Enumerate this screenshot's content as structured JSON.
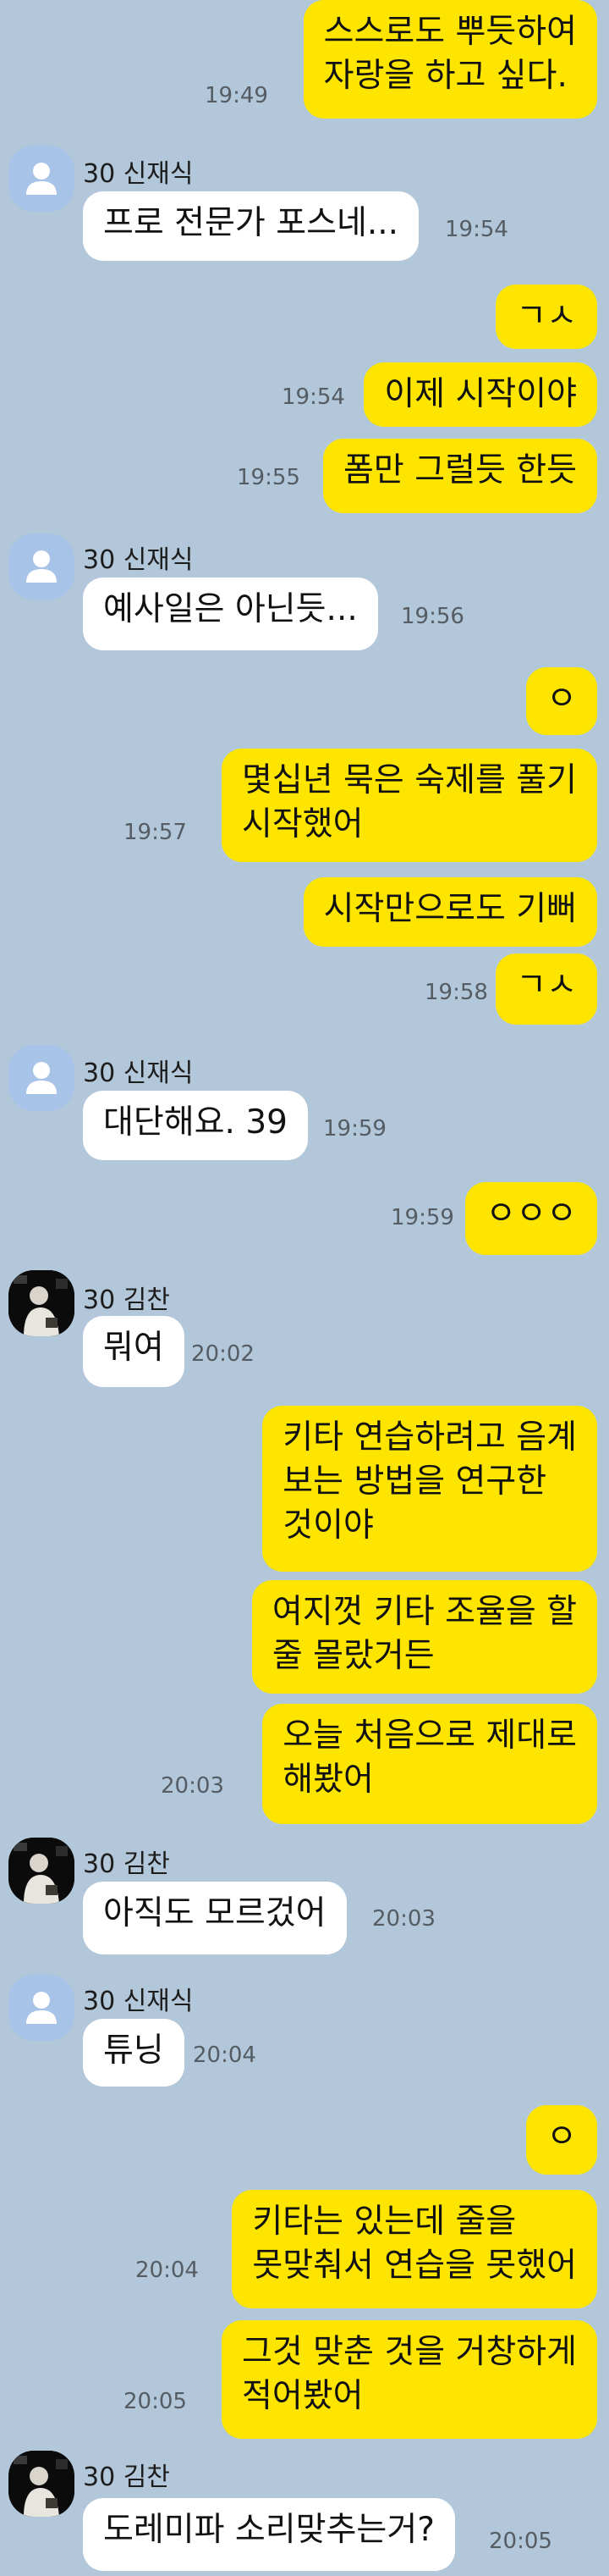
{
  "chat": {
    "messages": [
      {
        "side": "me",
        "text": "스스로도 뿌듯하여\n자랑을 하고 싶다.",
        "time": "19:49"
      },
      {
        "side": "them",
        "sender": "30 신재식",
        "avatar": "default",
        "text": "프로 전문가 포스네...",
        "time": "19:54"
      },
      {
        "side": "me",
        "text": "ㄱㅅ",
        "time": ""
      },
      {
        "side": "me",
        "text": "이제 시작이야",
        "time": "19:54"
      },
      {
        "side": "me",
        "text": "폼만 그럴듯 한듯",
        "time": "19:55"
      },
      {
        "side": "them",
        "sender": "30 신재식",
        "avatar": "default",
        "text": "예사일은 아닌듯...",
        "time": "19:56"
      },
      {
        "side": "me",
        "text": "ㅇ",
        "time": ""
      },
      {
        "side": "me",
        "text": "몇십년 묵은 숙제를 풀기\n시작했어",
        "time": "19:57"
      },
      {
        "side": "me",
        "text": "시작만으로도 기뻐",
        "time": ""
      },
      {
        "side": "me",
        "text": "ㄱㅅ",
        "time": "19:58"
      },
      {
        "side": "them",
        "sender": "30 신재식",
        "avatar": "default",
        "text": "대단해요. 39",
        "time": "19:59"
      },
      {
        "side": "me",
        "text": "ㅇㅇㅇ",
        "time": "19:59"
      },
      {
        "side": "them",
        "sender": "30 김찬",
        "avatar": "photo",
        "text": "뭐여",
        "time": "20:02"
      },
      {
        "side": "me",
        "text": "키타 연습하려고 음계\n보는 방법을 연구한\n것이야",
        "time": ""
      },
      {
        "side": "me",
        "text": "여지껏 키타 조율을 할\n줄 몰랐거든",
        "time": ""
      },
      {
        "side": "me",
        "text": "오늘 처음으로 제대로\n해봤어",
        "time": "20:03"
      },
      {
        "side": "them",
        "sender": "30 김찬",
        "avatar": "photo",
        "text": "아직도 모르겄어",
        "time": "20:03"
      },
      {
        "side": "them",
        "sender": "30 신재식",
        "avatar": "default",
        "text": "튜닝",
        "time": "20:04"
      },
      {
        "side": "me",
        "text": "ㅇ",
        "time": ""
      },
      {
        "side": "me",
        "text": "키타는 있는데 줄을\n못맞춰서 연습을 못했어",
        "time": "20:04"
      },
      {
        "side": "me",
        "text": "그것 맞춘 것을 거창하게\n적어봤어",
        "time": "20:05"
      },
      {
        "side": "them",
        "sender": "30 김찬",
        "avatar": "photo",
        "text": "도레미파 소리맞추는거?",
        "time": "20:05"
      }
    ]
  },
  "colors": {
    "background": "#b2c7d9",
    "my_bubble": "#fee500",
    "their_bubble": "#ffffff",
    "default_avatar": "#a8c3e8"
  },
  "icons": {
    "default_avatar": "person-silhouette-icon",
    "photo_avatar": "profile-photo-icon"
  }
}
